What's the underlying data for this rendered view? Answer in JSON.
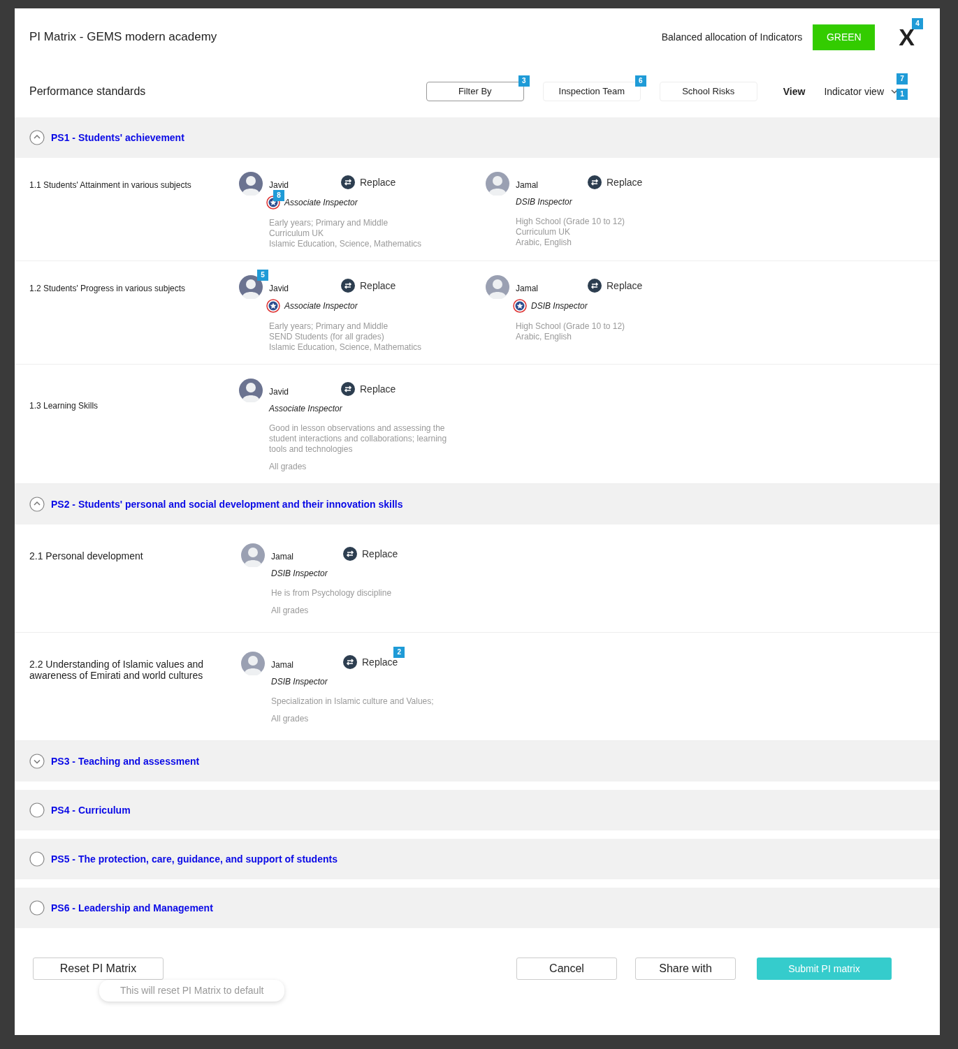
{
  "header": {
    "title": "PI Matrix - GEMS modern academy",
    "allocation_label": "Balanced allocation of Indicators",
    "allocation_status": "GREEN",
    "close": "X",
    "close_marker": "4"
  },
  "toolbar": {
    "title": "Performance standards",
    "filters": [
      {
        "label": "Filter By",
        "selected": true,
        "marker": "3"
      },
      {
        "label": "Inspection Team",
        "selected": false,
        "marker": "6"
      },
      {
        "label": "School Risks",
        "selected": false
      }
    ],
    "view_label": "View",
    "view_value": "Indicator view",
    "view_markers": [
      "7",
      "1"
    ]
  },
  "sections": [
    {
      "title": "PS1 - Students' achievement",
      "kind": "expanded",
      "rows": [
        {
          "label": "1.1 Students' Attainment in various subjects",
          "inspectors": [
            {
              "name": "Javid",
              "role": "Associate Inspector",
              "certified": true,
              "role_marker": "8",
              "color": "#6b7390",
              "details": [
                [
                  "Early years; Primary and Middle",
                  "Curriculum UK",
                  "Islamic Education, Science, Mathematics"
                ]
              ],
              "action": "Replace"
            },
            {
              "name": "Jamal",
              "role": "DSIB Inspector",
              "certified": false,
              "color": "#9aa0b2",
              "details": [
                [
                  "High School (Grade 10 to 12)",
                  "Curriculum UK",
                  "Arabic, English"
                ]
              ],
              "action": "Replace"
            }
          ]
        },
        {
          "label": "1.2 Students' Progress in various subjects",
          "inspectors": [
            {
              "name": "Javid",
              "role": "Associate Inspector",
              "certified": true,
              "color": "#6b7390",
              "avatar_marker": "5",
              "details": [
                [
                  "Early years; Primary and Middle",
                  "SEND Students (for all grades)",
                  "Islamic Education, Science, Mathematics"
                ]
              ],
              "action": "Replace"
            },
            {
              "name": "Jamal",
              "role": "DSIB Inspector",
              "certified": true,
              "color": "#9aa0b2",
              "details": [
                [
                  "High School (Grade 10 to 12)",
                  "Arabic, English"
                ]
              ],
              "action": "Replace"
            }
          ]
        },
        {
          "label": "1.3 Learning Skills",
          "inspectors": [
            {
              "name": "Javid",
              "role": "Associate Inspector",
              "certified": false,
              "color": "#6b7390",
              "details": [
                [
                  "Good in lesson observations and assessing the student interactions and collaborations; learning tools and technologies"
                ],
                [
                  "All grades"
                ]
              ],
              "action": "Replace"
            }
          ]
        }
      ]
    },
    {
      "title": "PS2 - Students' personal and social development and their innovation skills",
      "kind": "expanded",
      "rows": [
        {
          "label": "2.1 Personal development",
          "inspectors": [
            {
              "name": "Jamal",
              "role": "DSIB Inspector",
              "certified": false,
              "color": "#9aa0b2",
              "details": [
                [
                  "He is from Psychology discipline"
                ],
                [
                  "All grades"
                ]
              ],
              "action": "Replace"
            }
          ]
        },
        {
          "label": "2.2 Understanding of Islamic values and awareness of Emirati and world cultures",
          "inspectors": [
            {
              "name": "Jamal",
              "role": "DSIB Inspector",
              "certified": false,
              "color": "#9aa0b2",
              "details": [
                [
                  "Specialization in Islamic culture and Values;"
                ],
                [
                  "All grades"
                ]
              ],
              "action": "Replace",
              "action_marker": "2"
            }
          ]
        }
      ]
    },
    {
      "title": "PS3 - Teaching and assessment",
      "kind": "collapsed"
    },
    {
      "title": "PS4 - Curriculum",
      "kind": "empty"
    },
    {
      "title": "PS5 - The protection, care, guidance, and support of students",
      "kind": "empty"
    },
    {
      "title": "PS6 - Leadership and Management",
      "kind": "empty"
    }
  ],
  "footer": {
    "reset": "Reset PI Matrix",
    "reset_hint": "This will reset PI Matrix to default",
    "cancel": "Cancel",
    "share": "Share with",
    "submit": "Submit PI matrix"
  }
}
